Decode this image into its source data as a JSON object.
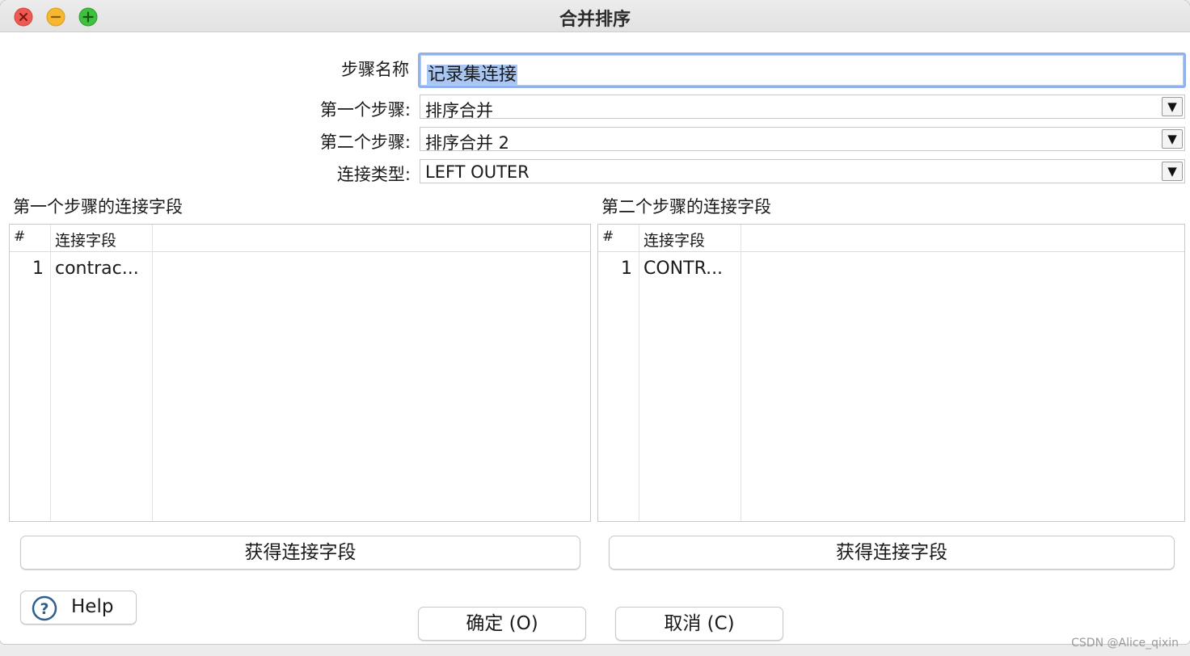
{
  "window": {
    "title": "合并排序"
  },
  "form": {
    "step_name_label": "步骤名称",
    "step_name_value": "记录集连接",
    "first_step_label": "第一个步骤:",
    "first_step_value": "排序合并",
    "second_step_label": "第二个步骤:",
    "second_step_value": "排序合并 2",
    "join_type_label": "连接类型:",
    "join_type_value": "LEFT OUTER",
    "dropdown_arrow": "▼"
  },
  "left_panel": {
    "title": "第一个步骤的连接字段",
    "col_index": "#",
    "col_field": "连接字段",
    "rows": [
      {
        "index": "1",
        "field": "contrac..."
      }
    ],
    "button_label": "获得连接字段"
  },
  "right_panel": {
    "title": "第二个步骤的连接字段",
    "col_index": "#",
    "col_field": "连接字段",
    "rows": [
      {
        "index": "1",
        "field": "CONTR..."
      }
    ],
    "button_label": "获得连接字段"
  },
  "footer": {
    "help_label": "Help",
    "ok_label": "确定 (O)",
    "cancel_label": "取消 (C)"
  },
  "watermark": "CSDN @Alice_qixin",
  "colors": {
    "close": "#ee5a52",
    "minimize": "#f5b82e",
    "maximize": "#3fc03f",
    "focus_ring": "#8fb2ef",
    "selection": "#a9c7f2"
  }
}
